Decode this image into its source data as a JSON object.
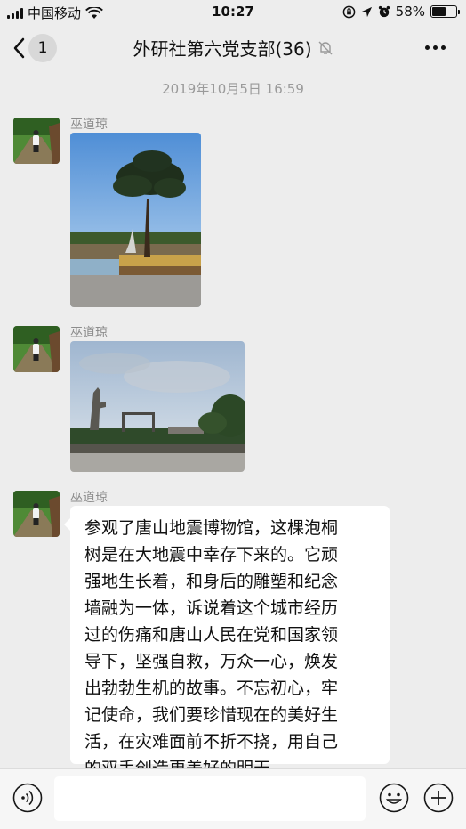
{
  "status_bar": {
    "carrier": "中国移动",
    "time": "10:27",
    "battery": "58%",
    "battery_level": 0.58,
    "icons": [
      "signal-icon",
      "wifi-icon",
      "orientation-lock-icon",
      "location-icon",
      "alarm-icon",
      "battery-icon"
    ]
  },
  "nav": {
    "back_count": "1",
    "title": "外研社第六党支部(36)",
    "icons": [
      "back-chevron-icon",
      "mute-bell-icon",
      "more-icon"
    ]
  },
  "timestamp": "2019年10月5日 16:59",
  "messages": [
    {
      "sender": "巫道琼",
      "type": "image",
      "image": "paulownia-tree-photo"
    },
    {
      "sender": "巫道琼",
      "type": "image",
      "image": "memorial-ruins-photo"
    },
    {
      "sender": "巫道琼",
      "type": "text",
      "lines": [
        "参观了唐山地震博物馆，这棵泡桐",
        "树是在大地震中幸存下来的。它顽",
        "强地生长着，和身后的雕塑和纪念",
        "墙融为一体，诉说着这个城市经历",
        "过的伤痛和唐山人民在党和国家领",
        "导下，坚强自救，万众一心，焕发",
        "出勃勃生机的故事。不忘初心，牢",
        "记使命，我们要珍惜现在的美好生",
        "活，在灾难面前不折不挠，用自己",
        "的双手创造更美好的明天。"
      ]
    }
  ],
  "input_bar": {
    "placeholder": "",
    "icons": [
      "voice-icon",
      "emoji-icon",
      "plus-icon"
    ]
  },
  "colors": {
    "background": "#ededed",
    "bubble": "#ffffff",
    "timestamp": "#9a9a9a",
    "sender": "#8c8c8c"
  }
}
